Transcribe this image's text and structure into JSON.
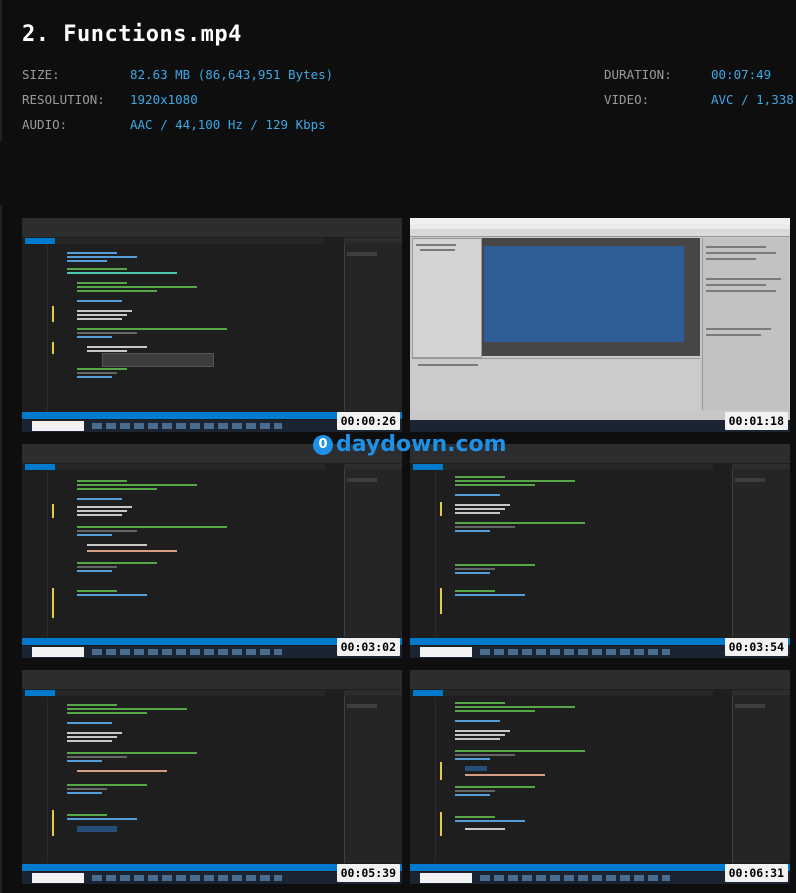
{
  "file": {
    "title": "2. Functions.mp4",
    "size_label": "SIZE:",
    "size_value": "82.63 MB (86,643,951 Bytes)",
    "resolution_label": "RESOLUTION:",
    "resolution_value": "1920x1080",
    "audio_label": "AUDIO:",
    "audio_value": "AAC / 44,100 Hz / 129 Kbps",
    "duration_label": "DURATION:",
    "duration_value": "00:07:49",
    "video_label": "VIDEO:",
    "video_value": "AVC / 1,338"
  },
  "watermark": {
    "icon": "0",
    "text": "daydown.com"
  },
  "thumbnails": [
    {
      "timestamp": "00:00:26",
      "scene": "visual-studio"
    },
    {
      "timestamp": "00:01:18",
      "scene": "unity-editor"
    },
    {
      "timestamp": "00:03:02",
      "scene": "visual-studio"
    },
    {
      "timestamp": "00:03:54",
      "scene": "visual-studio"
    },
    {
      "timestamp": "00:05:39",
      "scene": "visual-studio"
    },
    {
      "timestamp": "00:06:31",
      "scene": "visual-studio"
    }
  ],
  "colors": {
    "background": "#0e0e0e",
    "title": "#ffffff",
    "label": "#9a9a9a",
    "value": "#3fa7e6",
    "ide_status": "#007acc",
    "game_view": "#2f5d97"
  }
}
